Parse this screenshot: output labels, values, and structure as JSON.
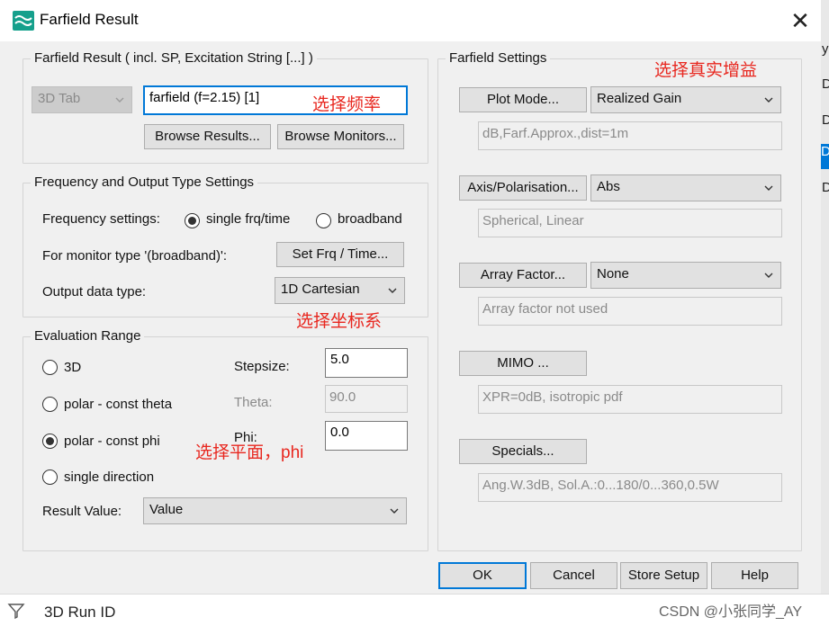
{
  "window": {
    "title": "Farfield Result",
    "close_glyph": "✕"
  },
  "farfield_result": {
    "legend": "Farfield Result ( incl. SP, Excitation String [...] )",
    "tab_combo": "3D Tab",
    "result_name": "farfield (f=2.15) [1]",
    "browse_results": "Browse Results...",
    "browse_monitors": "Browse Monitors..."
  },
  "freq_output": {
    "legend": "Frequency and Output Type Settings",
    "freq_label": "Frequency settings:",
    "radio_single": "single frq/time",
    "radio_broadband": "broadband",
    "monitor_label": "For monitor type '(broadband)':",
    "set_frq_button": "Set Frq / Time...",
    "output_label": "Output data type:",
    "output_value": "1D Cartesian"
  },
  "evaluation": {
    "legend": "Evaluation Range",
    "opt_3d": "3D",
    "opt_theta": "polar - const theta",
    "opt_phi": "polar - const phi",
    "opt_single": "single direction",
    "stepsize_label": "Stepsize:",
    "stepsize_value": "5.0",
    "theta_label": "Theta:",
    "theta_value": "90.0",
    "phi_label": "Phi:",
    "phi_value": "0.0",
    "result_value_label": "Result Value:",
    "result_value": "Value"
  },
  "farfield_settings": {
    "legend": "Farfield Settings",
    "plot_mode_button": "Plot Mode...",
    "plot_mode_value": "Realized Gain",
    "plot_mode_info": "dB,Farf.Approx.,dist=1m",
    "axis_button": "Axis/Polarisation...",
    "axis_value": "Abs",
    "axis_info": "Spherical, Linear",
    "array_button": "Array Factor...",
    "array_value": "None",
    "array_info": "Array factor not used",
    "mimo_button": "MIMO ...",
    "mimo_info": "XPR=0dB, isotropic pdf",
    "specials_button": "Specials...",
    "specials_info": "Ang.W.3dB, Sol.A.:0...180/0...360,0.5W"
  },
  "bottom_buttons": {
    "ok": "OK",
    "cancel": "Cancel",
    "store": "Store Setup",
    "help": "Help"
  },
  "annotations": {
    "freq": "选择频率",
    "gain": "选择真实增益",
    "coord": "选择坐标系",
    "plane": "选择平面，phi"
  },
  "bottom_bar": {
    "label": "3D Run ID",
    "watermark": "CSDN @小张同学_AY"
  },
  "right_strip_letters": [
    "y",
    "D",
    "D",
    "D",
    "D"
  ]
}
